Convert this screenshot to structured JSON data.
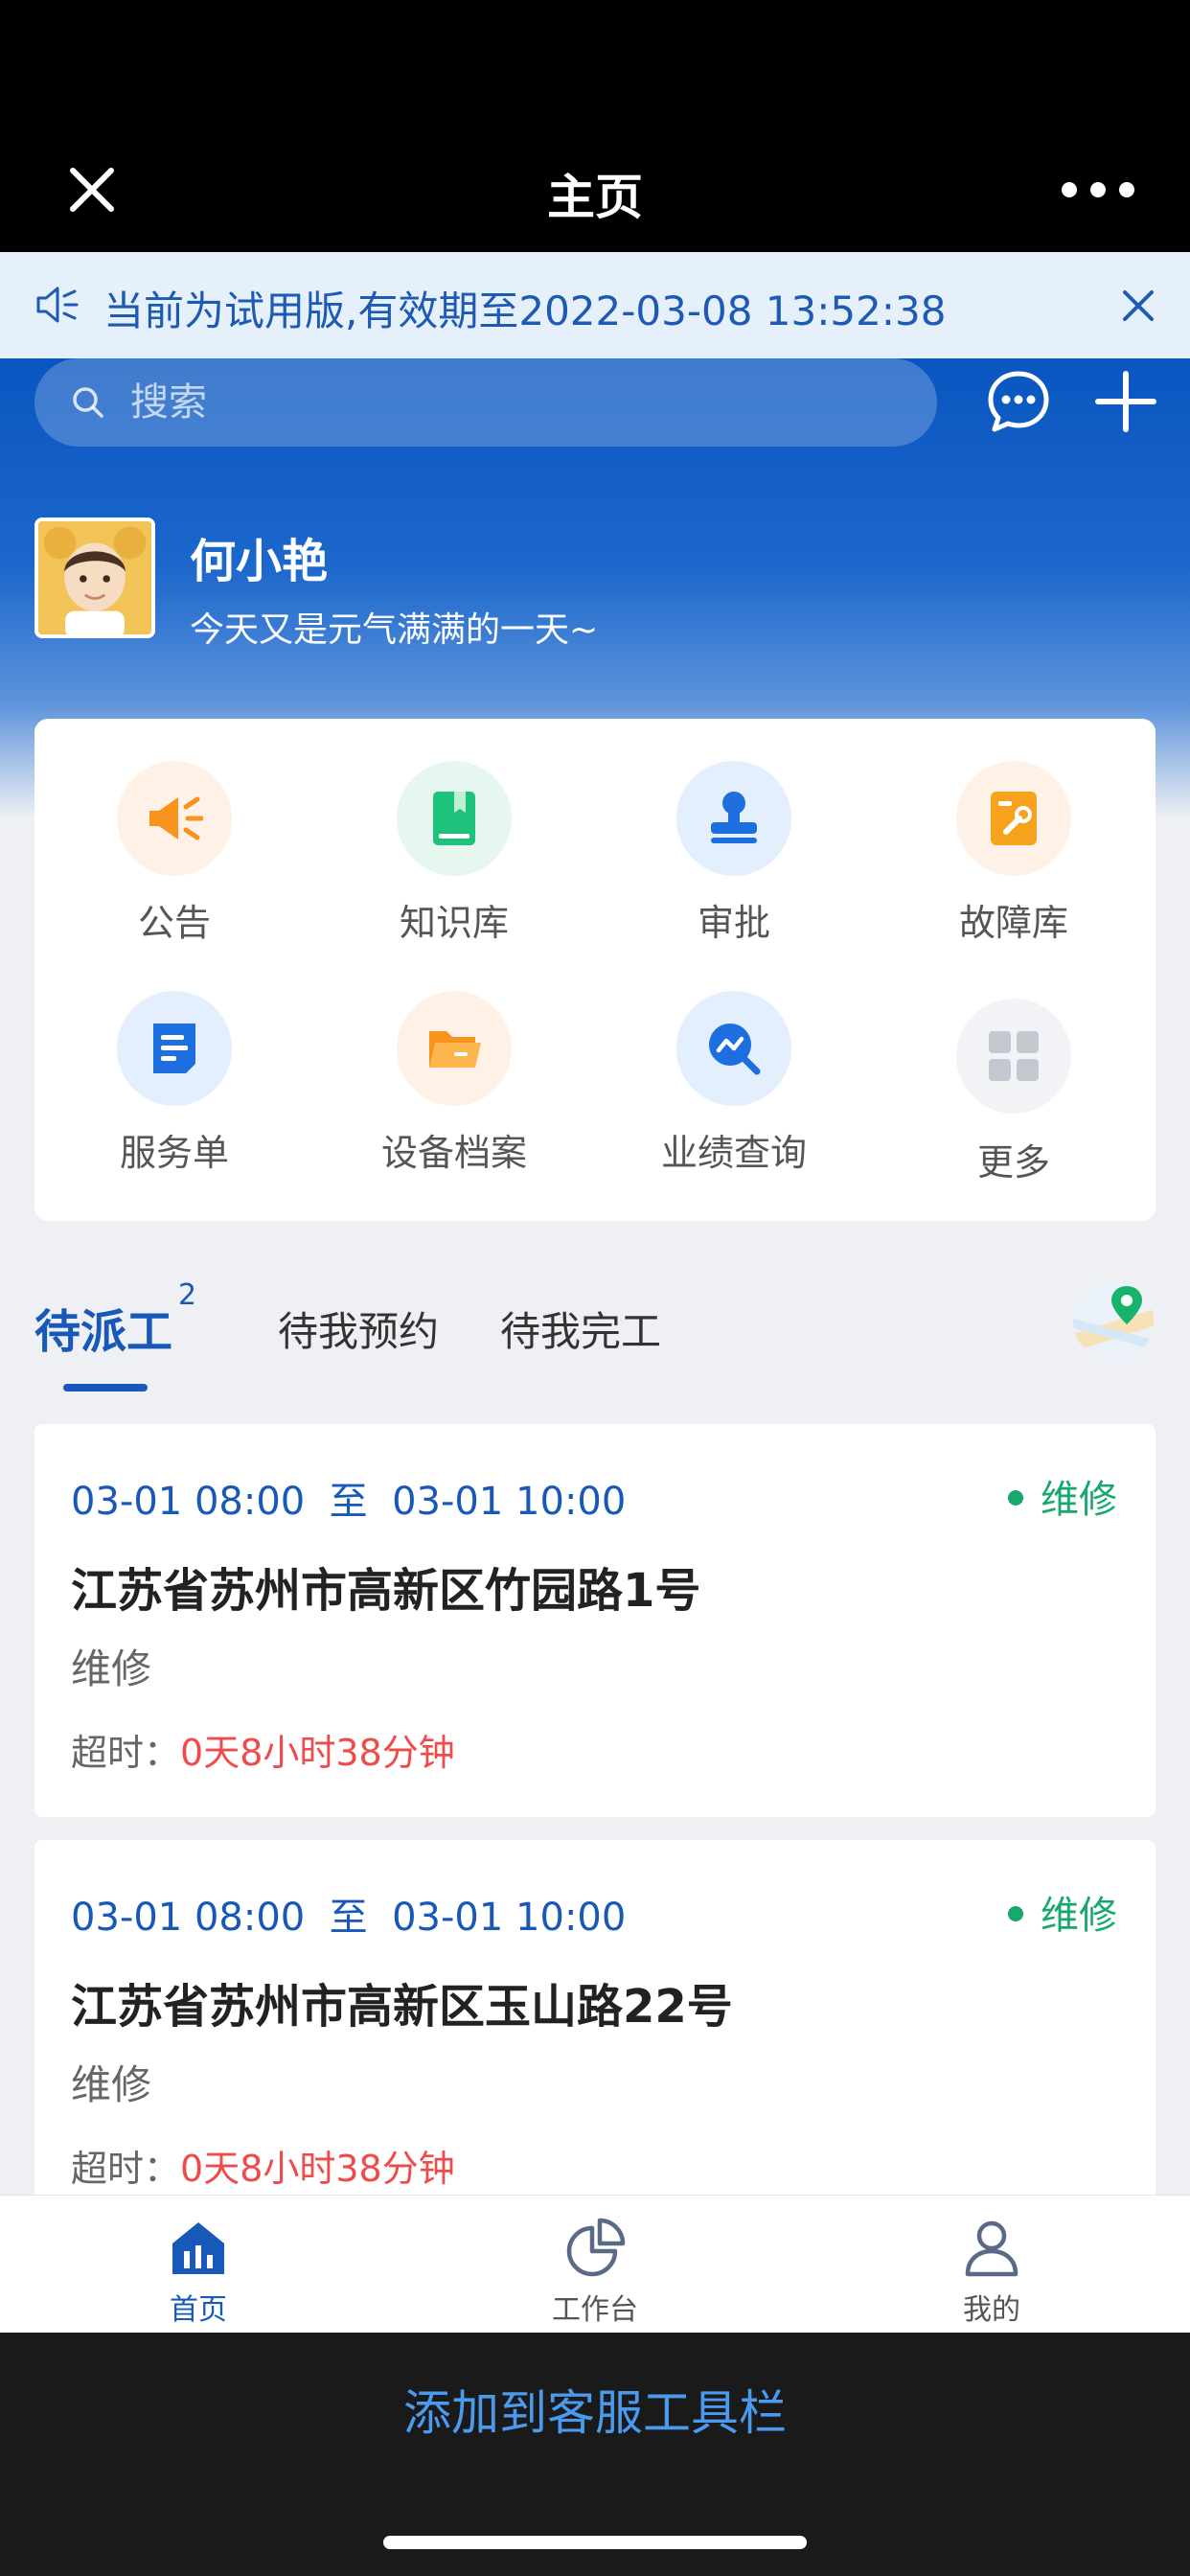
{
  "header": {
    "title": "主页",
    "close_icon": "close-icon",
    "more_icon": "more-dots-icon"
  },
  "notice": {
    "text": "当前为试用版,有效期至2022-03-08 13:52:38",
    "icon": "speaker-icon"
  },
  "search": {
    "placeholder": "搜索"
  },
  "user": {
    "name": "何小艳",
    "motto": "今天又是元气满满的一天~"
  },
  "grid": [
    {
      "label": "公告",
      "icon": "megaphone-icon",
      "color": "#fff1e5",
      "fg": "#f7941d"
    },
    {
      "label": "知识库",
      "icon": "book-icon",
      "color": "#e5f7ef",
      "fg": "#1ec27a"
    },
    {
      "label": "审批",
      "icon": "stamp-icon",
      "color": "#e3effc",
      "fg": "#1d6fe0"
    },
    {
      "label": "故障库",
      "icon": "wrench-doc-icon",
      "color": "#fff1e5",
      "fg": "#f7a21d"
    },
    {
      "label": "服务单",
      "icon": "document-icon",
      "color": "#e3effc",
      "fg": "#1d6fe0"
    },
    {
      "label": "设备档案",
      "icon": "folder-icon",
      "color": "#fff1e5",
      "fg": "#f7941d"
    },
    {
      "label": "业绩查询",
      "icon": "chart-search-icon",
      "color": "#e3effc",
      "fg": "#1d6fe0"
    },
    {
      "label": "更多",
      "icon": "grid-more-icon",
      "color": "#f2f3f6",
      "fg": "#c4c8d0"
    }
  ],
  "tabs": [
    {
      "label": "待派工",
      "badge": "2",
      "active": true
    },
    {
      "label": "待我预约"
    },
    {
      "label": "待我完工"
    }
  ],
  "orders": [
    {
      "start": "03-01 08:00",
      "sep": "至",
      "end": "03-01 10:00",
      "status": "维修",
      "address": "江苏省苏州市高新区竹园路1号",
      "type": "维修",
      "overtime_label": "超时：",
      "overtime": "0天8小时38分钟"
    },
    {
      "start": "03-01 08:00",
      "sep": "至",
      "end": "03-01 10:00",
      "status": "维修",
      "address": "江苏省苏州市高新区玉山路22号",
      "type": "维修",
      "overtime_label": "超时：",
      "overtime": "0天8小时38分钟"
    }
  ],
  "tabbar": [
    {
      "label": "首页",
      "icon": "home-icon",
      "active": true
    },
    {
      "label": "工作台",
      "icon": "pie-chart-icon"
    },
    {
      "label": "我的",
      "icon": "user-icon"
    }
  ],
  "bottom": {
    "add_label": "添加到客服工具栏"
  },
  "colors": {
    "primary": "#1858b8",
    "green": "#17a86c",
    "red": "#f04b4b"
  }
}
